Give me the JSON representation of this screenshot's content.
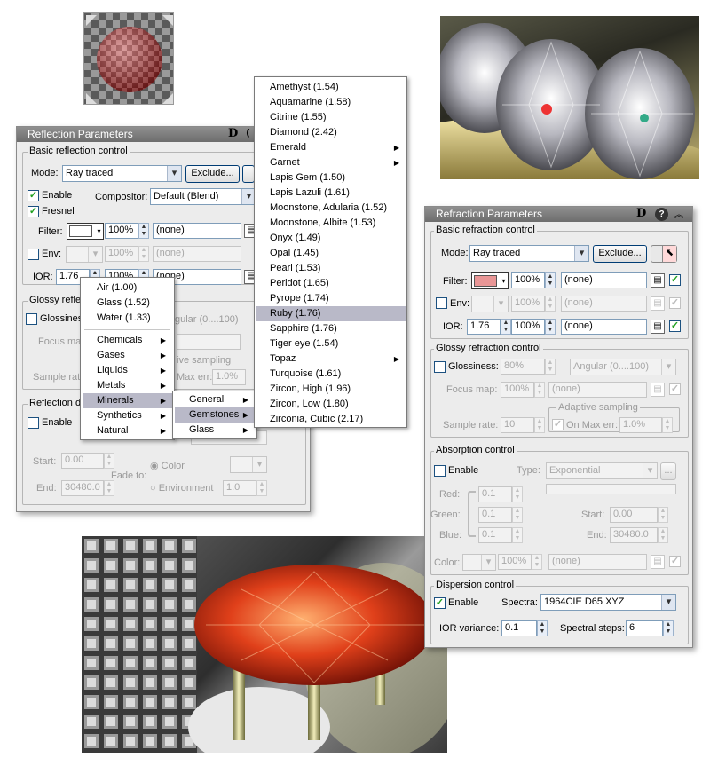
{
  "refl": {
    "title": "Reflection Parameters",
    "title_btn": "D",
    "basic": "Basic reflection control",
    "mode_label": "Mode:",
    "mode_value": "Ray traced",
    "exclude": "Exclude...",
    "enable": "Enable",
    "compositor_label": "Compositor:",
    "compositor_value": "Default (Blend)",
    "fresnel": "Fresnel",
    "filter_label": "Filter:",
    "pct": "100%",
    "none": "(none)",
    "env_label": "Env:",
    "ior_label": "IOR:",
    "ior_value": "1.76",
    "glossy": "Glossy reflec",
    "glossiness": "Glossiness",
    "angular": "gular (0....100)",
    "focus": "Focus map",
    "adaptive": "ive sampling",
    "sample": "Sample rate",
    "maxerr": "Max err:",
    "maxerr_value": "1.0%",
    "refl_dim": "Reflection d",
    "start": "Start:",
    "start_value": "0.00",
    "end": "End:",
    "end_value": "30480.0",
    "fadeto": "Fade to:",
    "color": "Color",
    "environment": "Environment",
    "env_value": "1.0"
  },
  "menu1": {
    "items": [
      "Air (1.00)",
      "Glass (1.52)",
      "Water (1.33)",
      "Chemicals",
      "Gases",
      "Liquids",
      "Metals",
      "Minerals",
      "Synthetics",
      "Natural"
    ]
  },
  "menu2": {
    "items": [
      "General",
      "Gemstones",
      "Glass"
    ]
  },
  "menu3": {
    "items": [
      "Amethyst (1.54)",
      "Aquamarine (1.58)",
      "Citrine (1.55)",
      "Diamond (2.42)",
      "Emerald",
      "Garnet",
      "Lapis Gem (1.50)",
      "Lapis Lazuli (1.61)",
      "Moonstone, Adularia (1.52)",
      "Moonstone, Albite (1.53)",
      "Onyx (1.49)",
      "Opal (1.45)",
      "Pearl (1.53)",
      "Peridot (1.65)",
      "Pyrope (1.74)",
      "Ruby (1.76)",
      "Sapphire (1.76)",
      "Tiger eye (1.54)",
      "Topaz",
      "Turquoise (1.61)",
      "Zircon, High (1.96)",
      "Zircon, Low (1.80)",
      "Zirconia, Cubic (2.17)"
    ]
  },
  "refr": {
    "title": "Refraction Parameters",
    "title_btn": "D",
    "basic": "Basic refraction control",
    "mode_label": "Mode:",
    "mode_value": "Ray traced",
    "exclude": "Exclude...",
    "filter_label": "Filter:",
    "pct": "100%",
    "none": "(none)",
    "env_label": "Env:",
    "ior_label": "IOR:",
    "ior_value": "1.76",
    "glossy": "Glossy refraction control",
    "glossiness": "Glossiness:",
    "gloss_value": "80%",
    "angular": "Angular (0....100)",
    "focus": "Focus map:",
    "adaptive": "Adaptive sampling",
    "sample": "Sample rate:",
    "sample_value": "10",
    "on_max": "On  Max err:",
    "maxerr_value": "1.0%",
    "absorption": "Absorption control",
    "enable": "Enable",
    "type": "Type:",
    "type_value": "Exponential",
    "red": "Red:",
    "green": "Green:",
    "blue": "Blue:",
    "rgb_value": "0.1",
    "start": "Start:",
    "start_value": "0.00",
    "end": "End:",
    "end_value": "30480.0",
    "color": "Color:",
    "dispersion": "Dispersion control",
    "spectra": "Spectra:",
    "spectra_value": "1964CIE D65 XYZ",
    "ior_var": "IOR variance:",
    "ior_var_value": "0.1",
    "steps": "Spectral steps:",
    "steps_value": "6"
  },
  "colors": {
    "ruby_swatch": "#e99696",
    "panel_bg": "#ececec",
    "title_bar": "#7d7d7d",
    "selection": "#b9b9c8"
  }
}
